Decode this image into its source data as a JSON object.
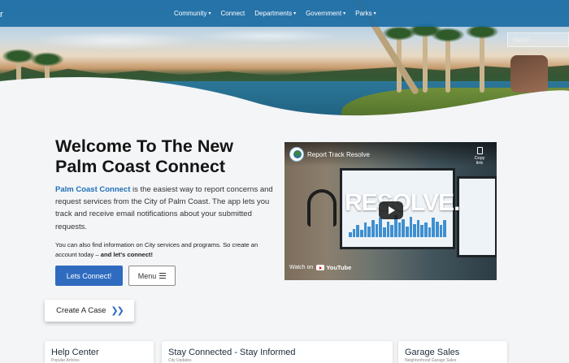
{
  "nav": {
    "brand_stub": "r",
    "items": [
      {
        "label": "Community",
        "caret": true
      },
      {
        "label": "Connect",
        "caret": false
      },
      {
        "label": "Departments",
        "caret": true
      },
      {
        "label": "Government",
        "caret": true
      },
      {
        "label": "Parks",
        "caret": true
      }
    ],
    "caret_glyph": "▾",
    "search_placeholder": "Search"
  },
  "welcome": {
    "title_line1": "Welcome To The New",
    "title_line2": "Palm Coast Connect",
    "intro_link": "Palm Coast Connect",
    "intro_text": " is the easiest way to report concerns and request services from the City of Palm Coast. The app lets you track and receive email notifications about your submitted requests.",
    "sub_text": "You can also find information on City services and programs. So create an account today – ",
    "sub_bold": "and let's connect!",
    "primary_button": "Lets Connect!",
    "menu_button": "Menu"
  },
  "video": {
    "title": "Report Track Resolve",
    "copy_link": "Copy link",
    "overlay_text": "RESOLVE.",
    "watch_on": "Watch on",
    "youtube": "YouTube",
    "chart_bar_levels": [
      0.2,
      0.35,
      0.5,
      0.3,
      0.6,
      0.45,
      0.7,
      0.55,
      0.8,
      0.4,
      0.65,
      0.5,
      0.9,
      0.6,
      0.75,
      0.45,
      0.85,
      0.55,
      0.7,
      0.5,
      0.6,
      0.4,
      0.8,
      0.65,
      0.5,
      0.7
    ]
  },
  "create_case": {
    "label": "Create A Case",
    "chevron": "❯❯"
  },
  "cards": [
    {
      "title": "Help Center",
      "subtitle": "Popular Articles"
    },
    {
      "title": "Stay Connected - Stay Informed",
      "subtitle": "City Updates"
    },
    {
      "title": "Garage Sales",
      "subtitle": "Neighborhood Garage Sales"
    }
  ],
  "colors": {
    "nav_bg": "#1b6ca4",
    "accent": "#2f6cc0",
    "link": "#1e6fb8"
  }
}
